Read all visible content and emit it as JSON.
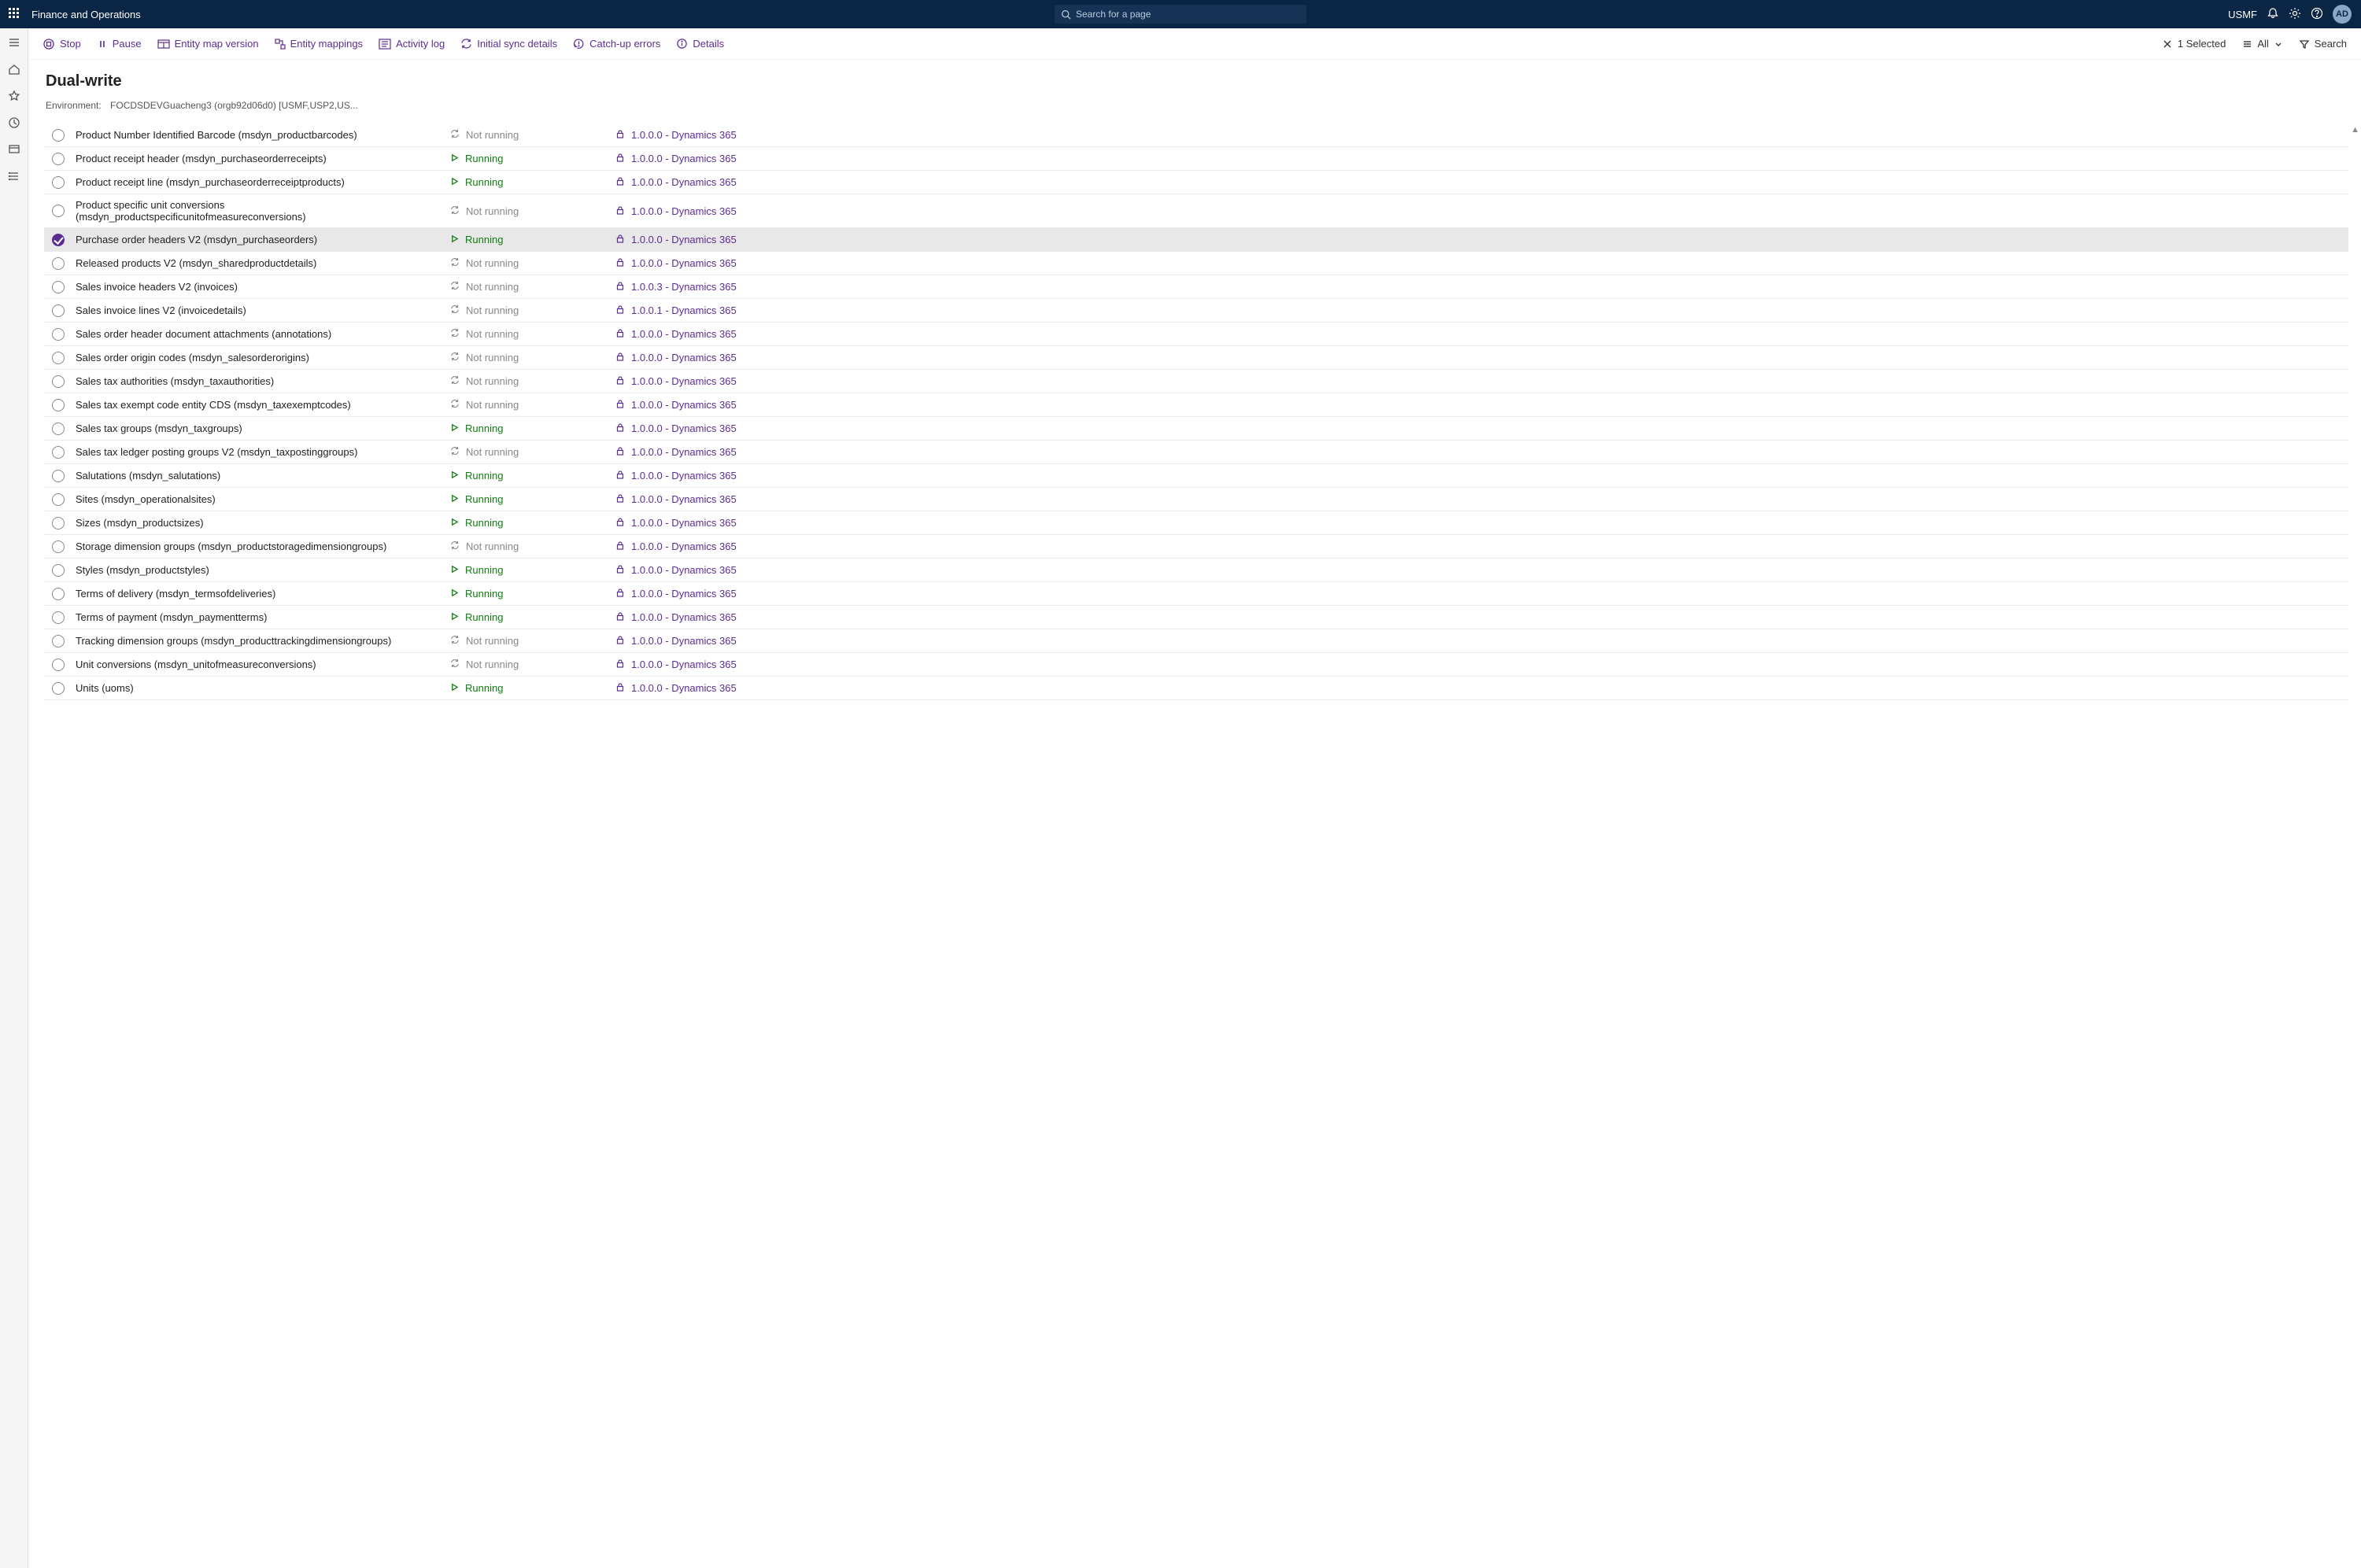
{
  "topbar": {
    "appname": "Finance and Operations",
    "search_placeholder": "Search for a page",
    "legal_entity": "USMF",
    "avatar_initials": "AD"
  },
  "toolbar": {
    "stop": "Stop",
    "pause": "Pause",
    "entity_map_version": "Entity map version",
    "entity_mappings": "Entity mappings",
    "activity_log": "Activity log",
    "initial_sync_details": "Initial sync details",
    "catch_up_errors": "Catch-up errors",
    "details": "Details",
    "selected_count": "1 Selected",
    "all": "All",
    "search": "Search"
  },
  "page": {
    "title": "Dual-write",
    "env_label": "Environment:",
    "env_value": "FOCDSDEVGuacheng3 (orgb92d06d0) [USMF,USP2,US..."
  },
  "status_labels": {
    "running": "Running",
    "notrunning": "Not running"
  },
  "rows": [
    {
      "name": "Product Number Identified Barcode (msdyn_productbarcodes)",
      "status": "notrunning",
      "version": "1.0.0.0 - Dynamics 365",
      "selected": false,
      "cutoff": true
    },
    {
      "name": "Product receipt header (msdyn_purchaseorderreceipts)",
      "status": "running",
      "version": "1.0.0.0 - Dynamics 365",
      "selected": false
    },
    {
      "name": "Product receipt line (msdyn_purchaseorderreceiptproducts)",
      "status": "running",
      "version": "1.0.0.0 - Dynamics 365",
      "selected": false
    },
    {
      "name": "Product specific unit conversions (msdyn_productspecificunitofmeasureconversions)",
      "status": "notrunning",
      "version": "1.0.0.0 - Dynamics 365",
      "selected": false
    },
    {
      "name": "Purchase order headers V2 (msdyn_purchaseorders)",
      "status": "running",
      "version": "1.0.0.0 - Dynamics 365",
      "selected": true
    },
    {
      "name": "Released products V2 (msdyn_sharedproductdetails)",
      "status": "notrunning",
      "version": "1.0.0.0 - Dynamics 365",
      "selected": false
    },
    {
      "name": "Sales invoice headers V2 (invoices)",
      "status": "notrunning",
      "version": "1.0.0.3 - Dynamics 365",
      "selected": false
    },
    {
      "name": "Sales invoice lines V2 (invoicedetails)",
      "status": "notrunning",
      "version": "1.0.0.1 - Dynamics 365",
      "selected": false
    },
    {
      "name": "Sales order header document attachments (annotations)",
      "status": "notrunning",
      "version": "1.0.0.0 - Dynamics 365",
      "selected": false
    },
    {
      "name": "Sales order origin codes (msdyn_salesorderorigins)",
      "status": "notrunning",
      "version": "1.0.0.0 - Dynamics 365",
      "selected": false
    },
    {
      "name": "Sales tax authorities (msdyn_taxauthorities)",
      "status": "notrunning",
      "version": "1.0.0.0 - Dynamics 365",
      "selected": false
    },
    {
      "name": "Sales tax exempt code entity CDS (msdyn_taxexemptcodes)",
      "status": "notrunning",
      "version": "1.0.0.0 - Dynamics 365",
      "selected": false
    },
    {
      "name": "Sales tax groups (msdyn_taxgroups)",
      "status": "running",
      "version": "1.0.0.0 - Dynamics 365",
      "selected": false
    },
    {
      "name": "Sales tax ledger posting groups V2 (msdyn_taxpostinggroups)",
      "status": "notrunning",
      "version": "1.0.0.0 - Dynamics 365",
      "selected": false
    },
    {
      "name": "Salutations (msdyn_salutations)",
      "status": "running",
      "version": "1.0.0.0 - Dynamics 365",
      "selected": false
    },
    {
      "name": "Sites (msdyn_operationalsites)",
      "status": "running",
      "version": "1.0.0.0 - Dynamics 365",
      "selected": false
    },
    {
      "name": "Sizes (msdyn_productsizes)",
      "status": "running",
      "version": "1.0.0.0 - Dynamics 365",
      "selected": false
    },
    {
      "name": "Storage dimension groups (msdyn_productstoragedimensiongroups)",
      "status": "notrunning",
      "version": "1.0.0.0 - Dynamics 365",
      "selected": false
    },
    {
      "name": "Styles (msdyn_productstyles)",
      "status": "running",
      "version": "1.0.0.0 - Dynamics 365",
      "selected": false
    },
    {
      "name": "Terms of delivery (msdyn_termsofdeliveries)",
      "status": "running",
      "version": "1.0.0.0 - Dynamics 365",
      "selected": false
    },
    {
      "name": "Terms of payment (msdyn_paymentterms)",
      "status": "running",
      "version": "1.0.0.0 - Dynamics 365",
      "selected": false
    },
    {
      "name": "Tracking dimension groups (msdyn_producttrackingdimensiongroups)",
      "status": "notrunning",
      "version": "1.0.0.0 - Dynamics 365",
      "selected": false
    },
    {
      "name": "Unit conversions (msdyn_unitofmeasureconversions)",
      "status": "notrunning",
      "version": "1.0.0.0 - Dynamics 365",
      "selected": false
    },
    {
      "name": "Units (uoms)",
      "status": "running",
      "version": "1.0.0.0 - Dynamics 365",
      "selected": false
    }
  ]
}
